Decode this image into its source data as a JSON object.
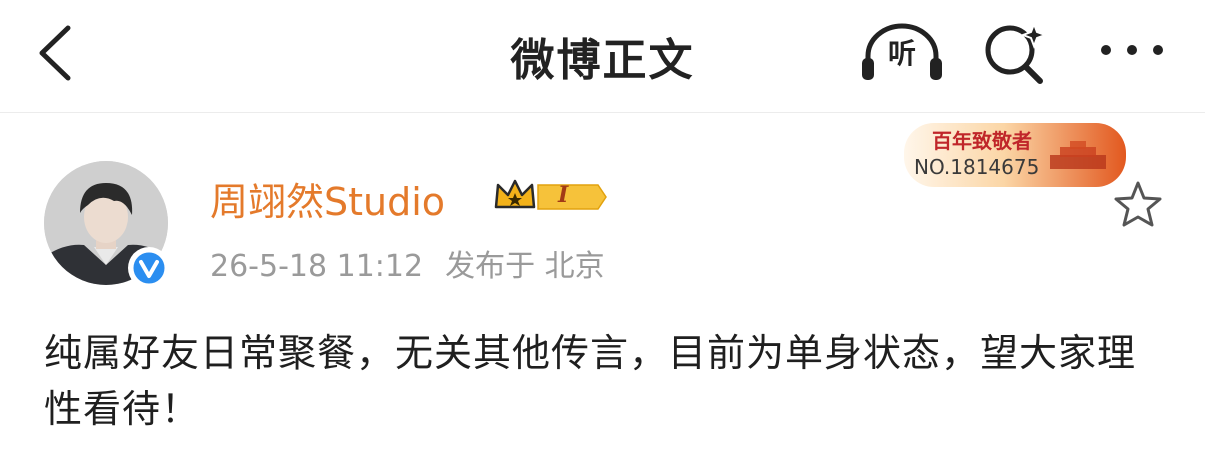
{
  "header": {
    "title": "微博正文",
    "listen_label": "听"
  },
  "post": {
    "author": {
      "name": "周翊然Studio",
      "level_badge": "I"
    },
    "meta": {
      "timestamp": "26-5-18 11:12",
      "location": "发布于 北京"
    },
    "anniversary_badge": {
      "title": "百年致敬者",
      "number": "NO.1814675"
    },
    "content": "纯属好友日常聚餐，无关其他传言，目前为单身状态，望大家理性看待！"
  },
  "colors": {
    "accent_orange": "#e47a2b",
    "meta_gray": "#9a9a9a",
    "verified_blue": "#2b8ef0",
    "badge_gold": "#f3b21a"
  },
  "icons": [
    "back-arrow-icon",
    "headphones-icon",
    "search-sparkle-icon",
    "more-icon",
    "verified-icon",
    "crown-icon",
    "star-icon"
  ]
}
